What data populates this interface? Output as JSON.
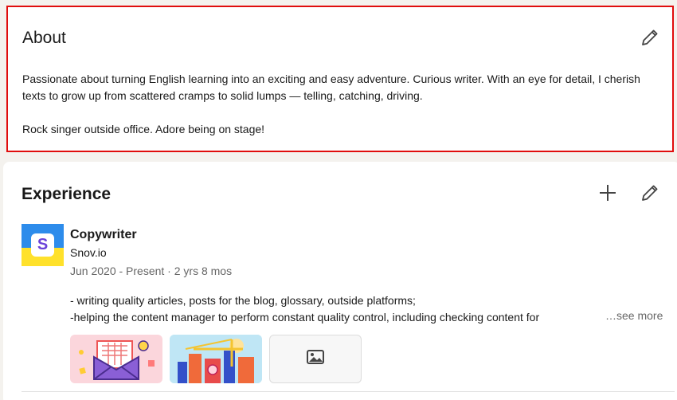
{
  "about": {
    "title": "About",
    "paragraph_1": "Passionate about turning English learning into an exciting and easy adventure. Curious writer. With an eye for detail, I cherish texts to grow up from scattered cramps to solid lumps — telling, catching, driving.",
    "paragraph_2": "Rock singer outside office. Adore being on stage!",
    "edit_icon": "pencil-icon"
  },
  "experience": {
    "title": "Experience",
    "add_icon": "plus-icon",
    "edit_icon": "pencil-icon",
    "items": [
      {
        "logo_letter": "S",
        "logo_colors": {
          "top": "#2d8ceb",
          "bottom": "#ffe12b",
          "letter": "#6a42d9"
        },
        "title": "Copywriter",
        "company": "Snov.io",
        "dates": "Jun 2020 - Present · 2 yrs 8 mos",
        "description_line_1": "- writing quality articles, posts for the blog, glossary, outside platforms;",
        "description_line_2": "-helping the content manager to perform constant quality control, including checking content for",
        "see_more": "…see more",
        "media": [
          "envelope-calendar-illustration",
          "city-construction-illustration",
          "image-placeholder-icon"
        ]
      }
    ]
  },
  "colors": {
    "highlight_border": "#e00d0d",
    "page_background": "#f4f2ee",
    "secondary_text": "#666666"
  }
}
